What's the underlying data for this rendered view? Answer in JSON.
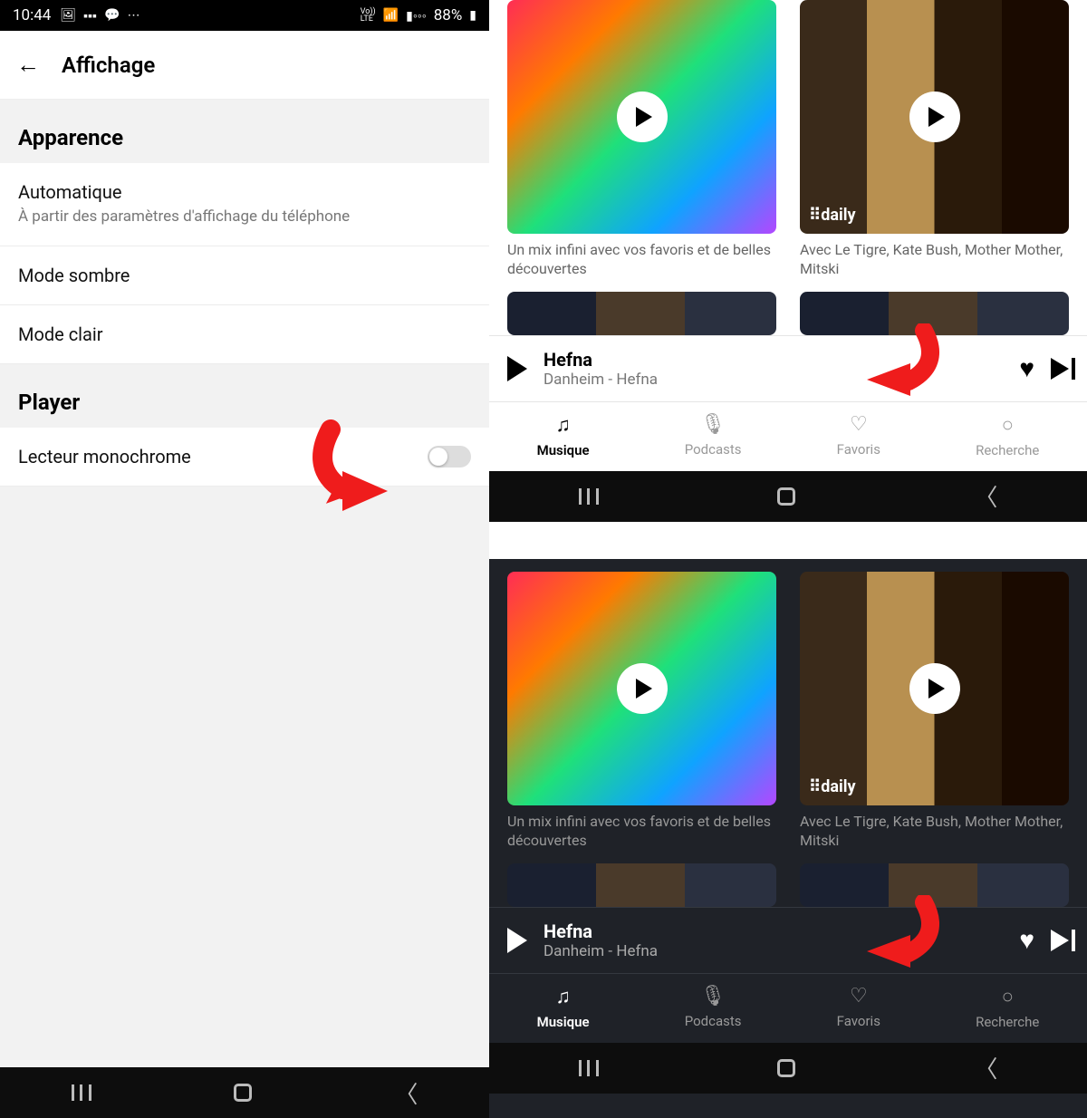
{
  "statusbar": {
    "time": "10:44",
    "volte": "Vo))\nLTE",
    "battery_pct": "88%"
  },
  "header": {
    "title": "Affichage"
  },
  "sections": {
    "appearance": {
      "title": "Apparence",
      "rows": {
        "auto": {
          "label": "Automatique",
          "sub": "À partir des paramètres d'affichage du téléphone"
        },
        "dark": {
          "label": "Mode sombre"
        },
        "light": {
          "label": "Mode clair"
        }
      }
    },
    "player": {
      "title": "Player",
      "rows": {
        "mono": {
          "label": "Lecteur monochrome"
        }
      }
    }
  },
  "music": {
    "subtitles": {
      "mix": "Un mix infini avec vos favoris et de belles découvertes",
      "daily": "Avec Le Tigre, Kate Bush, Mother Mother, Mitski"
    },
    "daily_label": "daily",
    "miniplayer": {
      "title": "Hefna",
      "artist": "Danheim - Hefna"
    },
    "tabs": {
      "music": "Musique",
      "podcasts": "Podcasts",
      "favs": "Favoris",
      "search": "Recherche"
    }
  }
}
